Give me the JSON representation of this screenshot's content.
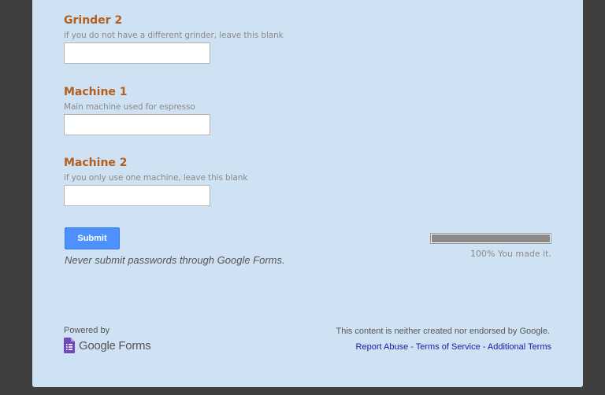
{
  "form": {
    "questions": [
      {
        "title": "Grinder 2",
        "help": "if you do not have a different grinder, leave this blank",
        "value": ""
      },
      {
        "title": "Machine 1",
        "help": "Main machine used for espresso",
        "value": ""
      },
      {
        "title": "Machine 2",
        "help": "if you only use one machine, leave this blank",
        "value": ""
      }
    ],
    "submit_label": "Submit",
    "password_warning": "Never submit passwords through Google Forms."
  },
  "progress": {
    "percent": 100,
    "label": "100% You made it."
  },
  "footer": {
    "powered_by": "Powered by",
    "brand_text": "Google Forms",
    "disclaimer": "This content is neither created nor endorsed by Google.",
    "links": [
      "Report Abuse",
      "Terms of Service",
      "Additional Terms"
    ],
    "separator": " - "
  },
  "colors": {
    "page_bg": "#3f3f3f",
    "card_bg": "#cfe2f3",
    "title": "#b45f1d",
    "button": "#4d90fe",
    "logo": "#7248b9"
  }
}
